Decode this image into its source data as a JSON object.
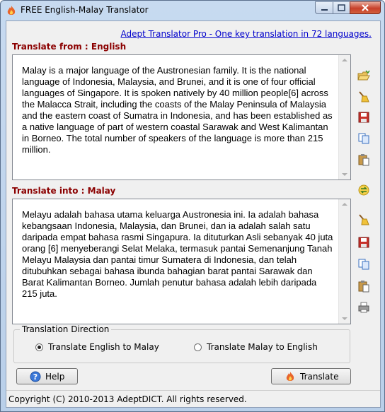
{
  "window": {
    "title": "FREE English-Malay Translator"
  },
  "promo_link": "Adept Translator Pro - One key translation in 72 languages.",
  "source": {
    "label": "Translate from : English",
    "text": "Malay is a major language of the Austronesian family. It is the national language of Indonesia, Malaysia, and Brunei, and it is one of four official languages of Singapore. It is spoken natively by 40 million people[6] across the Malacca Strait, including the coasts of the Malay Peninsula of Malaysia and the eastern coast of Sumatra in Indonesia, and has been established as a native language of part of western coastal Sarawak and West Kalimantan in Borneo. The total number of speakers of the language is more than 215 million."
  },
  "target": {
    "label": "Translate into : Malay",
    "text": "Melayu adalah bahasa utama keluarga Austronesia ini. Ia adalah bahasa kebangsaan Indonesia, Malaysia, dan Brunei, dan ia adalah salah satu daripada empat bahasa rasmi Singapura. Ia dituturkan Asli sebanyak 40 juta orang [6] menyeberangi Selat Melaka, termasuk pantai Semenanjung Tanah Melayu Malaysia dan pantai timur Sumatera di Indonesia, dan telah ditubuhkan sebagai bahasa ibunda bahagian barat pantai Sarawak dan Barat Kalimantan Borneo. Jumlah penutur bahasa adalah lebih daripada 215 juta."
  },
  "direction": {
    "group_label": "Translation Direction",
    "options": [
      {
        "label": "Translate English to Malay",
        "selected": true
      },
      {
        "label": "Translate Malay to English",
        "selected": false
      }
    ]
  },
  "buttons": {
    "help": "Help",
    "translate": "Translate"
  },
  "status": "Copyright (C) 2010-2013 AdeptDICT. All rights reserved.",
  "icons": {
    "source_tools": [
      "open-folder-icon",
      "clear-broom-icon",
      "save-icon",
      "copy-icon",
      "paste-icon"
    ],
    "swap": "swap-direction-icon",
    "target_tools": [
      "clear-broom-icon",
      "save-icon",
      "copy-icon",
      "paste-icon",
      "print-icon"
    ]
  },
  "colors": {
    "section_label": "#8b0000",
    "link": "#0000cc"
  }
}
